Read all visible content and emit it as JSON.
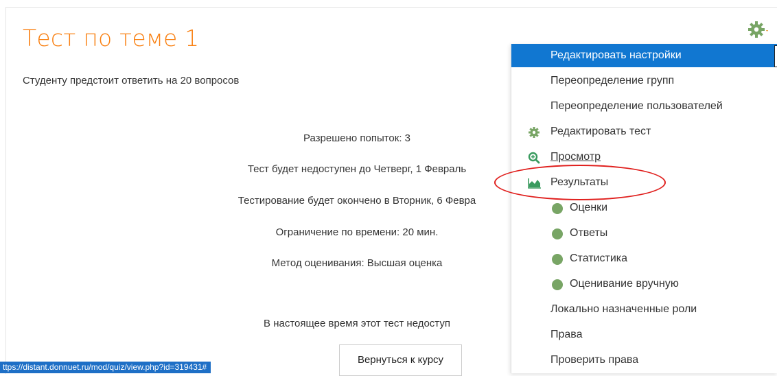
{
  "quiz": {
    "title": "Тест по теме 1",
    "description": "Студенту предстоит ответить на 20 вопросов",
    "info": [
      "Разрешено попыток: 3",
      "Тест будет недоступен до Четверг, 1 Февраль",
      "Тестирование будет окончено в Вторник, 6 Февра",
      "Ограничение по времени: 20 мин.",
      "Метод оценивания: Высшая оценка"
    ],
    "availability": "В настоящее время этот тест недоступ",
    "back_button": "Вернуться к курсу"
  },
  "menu": {
    "items": [
      {
        "label": "Редактировать настройки",
        "icon": null
      },
      {
        "label": "Переопределение групп",
        "icon": null
      },
      {
        "label": "Переопределение пользователей",
        "icon": null
      },
      {
        "label": "Редактировать тест",
        "icon": "gear-icon"
      },
      {
        "label": "Просмотр",
        "icon": "zoom-icon"
      },
      {
        "label": "Результаты",
        "icon": "chart-icon"
      },
      {
        "label": "Оценки",
        "icon": "dot"
      },
      {
        "label": "Ответы",
        "icon": "dot"
      },
      {
        "label": "Статистика",
        "icon": "dot"
      },
      {
        "label": "Оценивание вручную",
        "icon": "dot"
      },
      {
        "label": "Локально назначенные роли",
        "icon": null
      },
      {
        "label": "Права",
        "icon": null
      },
      {
        "label": "Проверить права",
        "icon": null
      }
    ]
  },
  "status_bar": {
    "url": "ttps://distant.donnuet.ru/mod/quiz/view.php?id=319431#"
  },
  "colors": {
    "accent": "#1177d1",
    "title": "#f98012",
    "dot": "#78a565",
    "highlight_oval": "#e0201e"
  }
}
